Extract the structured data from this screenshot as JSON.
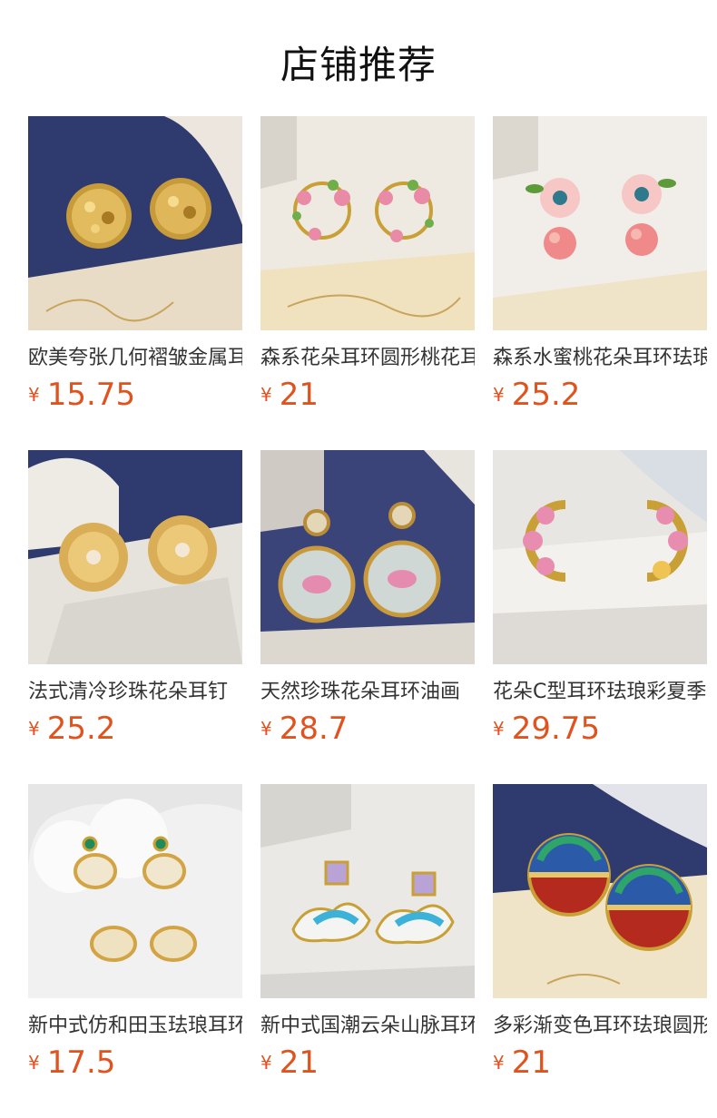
{
  "page": {
    "title": "店铺推荐"
  },
  "colors": {
    "price": "#e0521e",
    "title": "#111111",
    "name": "#333333"
  },
  "products": [
    {
      "name": "欧美夸张几何褶皱金属耳钉",
      "currency": "¥",
      "price": "15.75",
      "image_icon": "gold-textured-stud-earrings-image"
    },
    {
      "name": "森系花朵耳环圆形桃花耳钉",
      "currency": "¥",
      "price": "21",
      "image_icon": "flower-wreath-earrings-image"
    },
    {
      "name": "森系水蜜桃花朵耳环珐琅",
      "currency": "¥",
      "price": "25.2",
      "image_icon": "peach-flower-drop-earrings-image"
    },
    {
      "name": "法式清冷珍珠花朵耳钉",
      "currency": "¥",
      "price": "25.2",
      "image_icon": "gold-daisy-pearl-stud-image"
    },
    {
      "name": "天然珍珠花朵耳环油画",
      "currency": "¥",
      "price": "28.7",
      "image_icon": "lotus-disc-pearl-earrings-image"
    },
    {
      "name": "花朵C型耳环珐琅彩夏季",
      "currency": "¥",
      "price": "29.75",
      "image_icon": "flower-c-hoop-earrings-image"
    },
    {
      "name": "新中式仿和田玉珐琅耳环",
      "currency": "¥",
      "price": "17.5",
      "image_icon": "jade-oval-earrings-image"
    },
    {
      "name": "新中式国潮云朵山脉耳环",
      "currency": "¥",
      "price": "21",
      "image_icon": "cloud-mountain-earrings-image"
    },
    {
      "name": "多彩渐变色耳环珐琅圆形",
      "currency": "¥",
      "price": "21",
      "image_icon": "gradient-enamel-disc-earrings-image"
    }
  ]
}
